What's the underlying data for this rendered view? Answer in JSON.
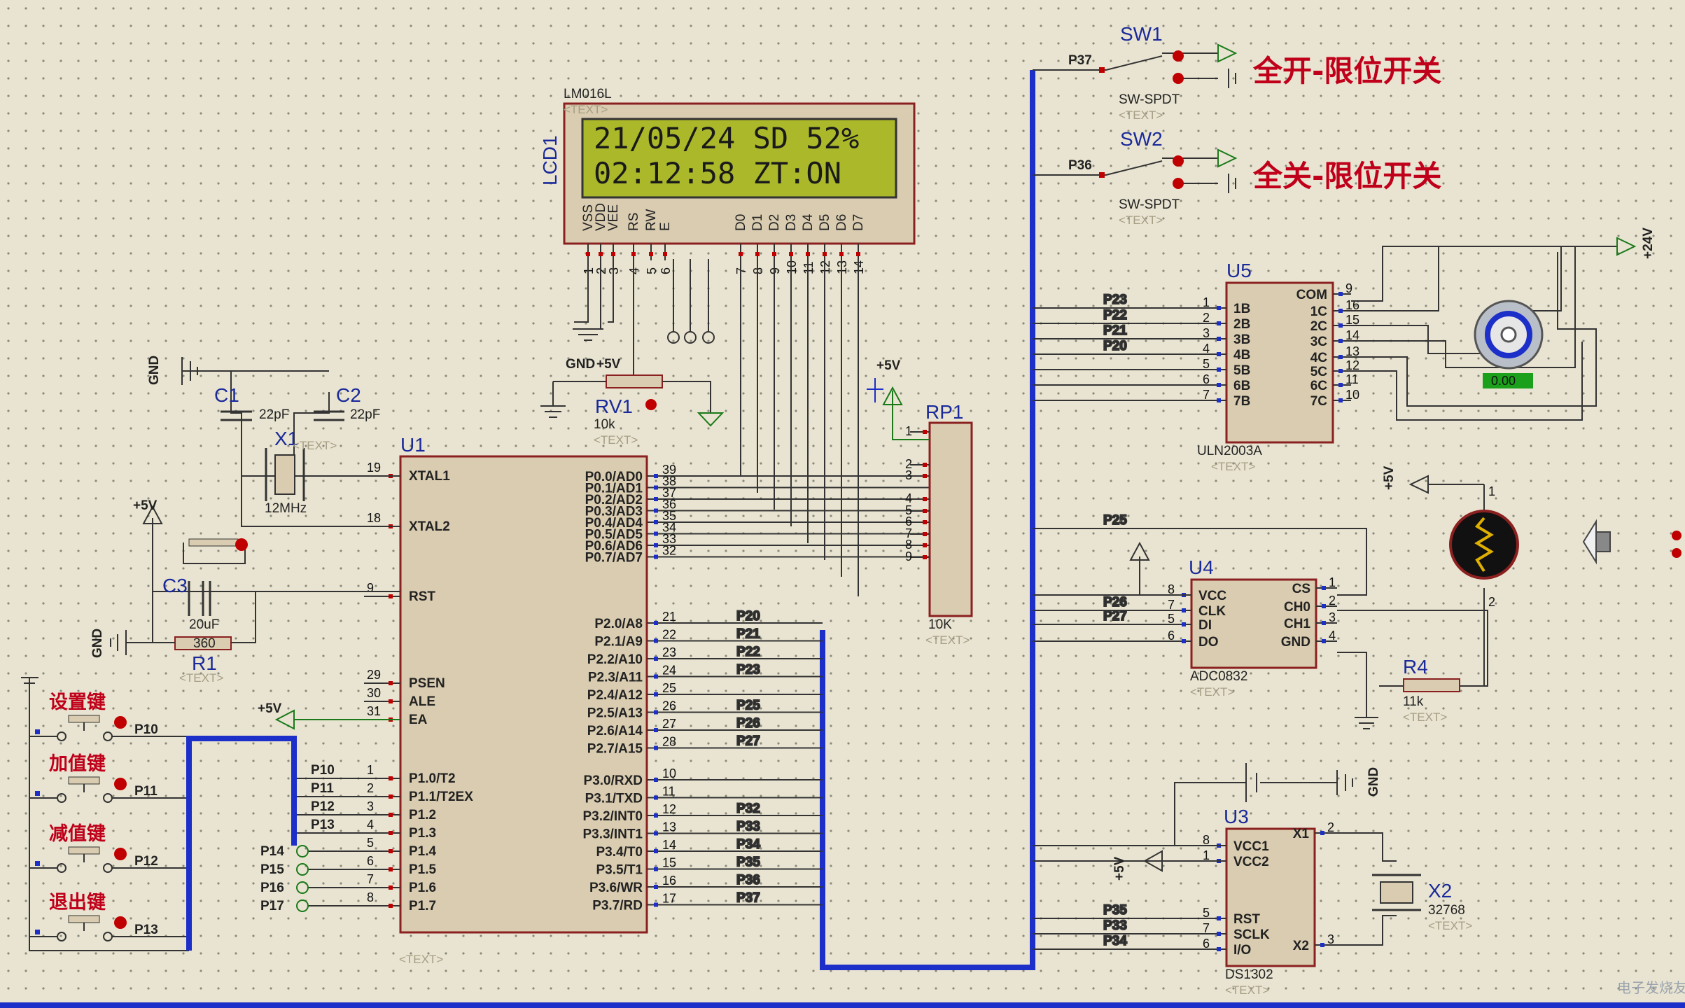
{
  "lcd": {
    "name": "LCD1",
    "model": "LM016L",
    "placeholder": "<TEXT>",
    "line1": "21/05/24 SD  52%",
    "line2": "02:12:58  ZT:ON",
    "pin_labels": [
      "VSS",
      "VDD",
      "VEE",
      "RS",
      "RW",
      "E",
      "D0",
      "D1",
      "D2",
      "D3",
      "D4",
      "D5",
      "D6",
      "D7"
    ],
    "pin_numbers": [
      "1",
      "2",
      "3",
      "4",
      "5",
      "6",
      "7",
      "8",
      "9",
      "10",
      "11",
      "12",
      "13",
      "14"
    ]
  },
  "mcu": {
    "name": "U1",
    "placeholder": "<TEXT>",
    "left_pins": [
      [
        "19",
        "XTAL1"
      ],
      [
        "18",
        "XTAL2"
      ],
      [
        "9",
        "RST"
      ],
      [
        "29",
        "PSEN"
      ],
      [
        "30",
        "ALE"
      ],
      [
        "31",
        "EA"
      ],
      [
        "1",
        "P1.0/T2"
      ],
      [
        "2",
        "P1.1/T2EX"
      ],
      [
        "3",
        "P1.2"
      ],
      [
        "4",
        "P1.3"
      ],
      [
        "5",
        "P1.4"
      ],
      [
        "6",
        "P1.5"
      ],
      [
        "7",
        "P1.6"
      ],
      [
        "8",
        "P1.7"
      ]
    ],
    "right_pins": [
      [
        "39",
        "P0.0/AD0"
      ],
      [
        "38",
        "P0.1/AD1"
      ],
      [
        "37",
        "P0.2/AD2"
      ],
      [
        "36",
        "P0.3/AD3"
      ],
      [
        "35",
        "P0.4/AD4"
      ],
      [
        "34",
        "P0.5/AD5"
      ],
      [
        "33",
        "P0.6/AD6"
      ],
      [
        "32",
        "P0.7/AD7"
      ],
      [
        "21",
        "P2.0/A8"
      ],
      [
        "22",
        "P2.1/A9"
      ],
      [
        "23",
        "P2.2/A10"
      ],
      [
        "24",
        "P2.3/A11"
      ],
      [
        "25",
        "P2.4/A12"
      ],
      [
        "26",
        "P2.5/A13"
      ],
      [
        "27",
        "P2.6/A14"
      ],
      [
        "28",
        "P2.7/A15"
      ],
      [
        "10",
        "P3.0/RXD"
      ],
      [
        "11",
        "P3.1/TXD"
      ],
      [
        "12",
        "P3.2/INT0"
      ],
      [
        "13",
        "P3.3/INT1"
      ],
      [
        "14",
        "P3.4/T0"
      ],
      [
        "15",
        "P3.5/T1"
      ],
      [
        "16",
        "P3.6/WR"
      ],
      [
        "17",
        "P3.7/RD"
      ]
    ],
    "net_p2": [
      "P20",
      "P21",
      "P22",
      "P23",
      "",
      "P25",
      "P26",
      "P27"
    ],
    "net_p3": [
      "",
      "",
      "P32",
      "P33",
      "P34",
      "P35",
      "P36",
      "P37"
    ],
    "net_p1": [
      "P10",
      "P11",
      "P12",
      "P13",
      "P14",
      "P15",
      "P16",
      "P17"
    ]
  },
  "rp1": {
    "name": "RP1",
    "value": "10K",
    "placeholder": "<TEXT>",
    "pins": [
      "1",
      "2",
      "3",
      "4",
      "5",
      "6",
      "7",
      "8",
      "9"
    ]
  },
  "rv1": {
    "name": "RV1",
    "value": "10k",
    "placeholder": "<TEXT>"
  },
  "crystal": {
    "c1": "C1",
    "c2": "C2",
    "c1v": "22pF",
    "c2v": "22pF",
    "x1": "X1",
    "x1v": "12MHz",
    "placeholder": "<TEXT>"
  },
  "reset": {
    "c3": "C3",
    "c3v": "20uF",
    "r1": "R1",
    "r1v": "360",
    "placeholder": "<TEXT>"
  },
  "power": {
    "vcc": "+5V",
    "gnd": "GND",
    "v24": "+24V"
  },
  "keys": [
    {
      "label": "设置键",
      "net": "P10"
    },
    {
      "label": "加值键",
      "net": "P11"
    },
    {
      "label": "减值键",
      "net": "P12"
    },
    {
      "label": "退出键",
      "net": "P13"
    }
  ],
  "switches": [
    {
      "name": "SW1",
      "type": "SW-SPDT",
      "net": "P37",
      "label": "全开-限位开关",
      "placeholder": "<TEXT>"
    },
    {
      "name": "SW2",
      "type": "SW-SPDT",
      "net": "P36",
      "label": "全关-限位开关",
      "placeholder": "<TEXT>"
    }
  ],
  "u5": {
    "name": "U5",
    "model": "ULN2003A",
    "placeholder": "<TEXT>",
    "left": [
      [
        "1",
        "1B"
      ],
      [
        "2",
        "2B"
      ],
      [
        "3",
        "3B"
      ],
      [
        "4",
        "4B"
      ],
      [
        "5",
        "5B"
      ],
      [
        "6",
        "6B"
      ],
      [
        "7",
        "7B"
      ]
    ],
    "right": [
      [
        "9",
        "COM"
      ],
      [
        "16",
        "1C"
      ],
      [
        "15",
        "2C"
      ],
      [
        "14",
        "3C"
      ],
      [
        "13",
        "4C"
      ],
      [
        "12",
        "5C"
      ],
      [
        "11",
        "6C"
      ],
      [
        "10",
        "7C"
      ]
    ],
    "nets": [
      "P23",
      "P22",
      "P21",
      "P20"
    ]
  },
  "u4": {
    "name": "U4",
    "model": "ADC0832",
    "placeholder": "<TEXT>",
    "left": [
      [
        "8",
        "VCC"
      ],
      [
        "7",
        "CLK"
      ],
      [
        "5",
        "DI"
      ],
      [
        "6",
        "DO"
      ]
    ],
    "right": [
      [
        "1",
        "CS"
      ],
      [
        "2",
        "CH0"
      ],
      [
        "3",
        "CH1"
      ],
      [
        "4",
        "GND"
      ]
    ],
    "nets": [
      "P25",
      "P26",
      "P27"
    ]
  },
  "r4": {
    "name": "R4",
    "value": "11k",
    "placeholder": "<TEXT>"
  },
  "ldr_pins": [
    "1",
    "2"
  ],
  "u3": {
    "name": "U3",
    "model": "DS1302",
    "placeholder": "<TEXT>",
    "left": [
      [
        "8",
        "VCC1"
      ],
      [
        "1",
        "VCC2"
      ],
      [
        "5",
        "RST"
      ],
      [
        "7",
        "SCLK"
      ],
      [
        "6",
        "I/O"
      ]
    ],
    "right": [
      [
        "2",
        "X1"
      ],
      [
        "3",
        "X2"
      ]
    ],
    "nets": [
      "P35",
      "P33",
      "P34"
    ]
  },
  "x2": {
    "name": "X2",
    "value": "32768",
    "placeholder": "<TEXT>"
  },
  "motor_label": "0.00",
  "watermark": "电子发烧友"
}
